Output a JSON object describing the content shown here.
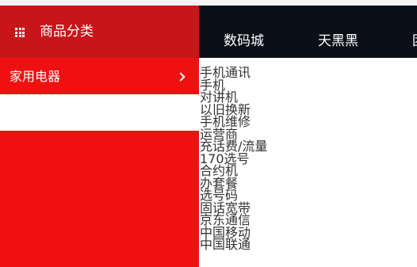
{
  "nav": {
    "category_title": "商品分类",
    "links": [
      "数码城",
      "天黑黑",
      "团"
    ]
  },
  "menu": {
    "active_item": "家用电器"
  },
  "submenu": {
    "items": [
      "手机通讯",
      "手机",
      "对讲机",
      "以旧换新",
      "手机维修",
      "运营商",
      "充话费/流量",
      "170选号",
      "合约机",
      "办套餐",
      "选号码",
      "固话宽带",
      "京东通信",
      "中国移动",
      "中国联通"
    ]
  },
  "colors": {
    "category_header_bg": "#c81519",
    "menu_bg": "#ef1111",
    "navbar_bg": "#0b1018"
  }
}
